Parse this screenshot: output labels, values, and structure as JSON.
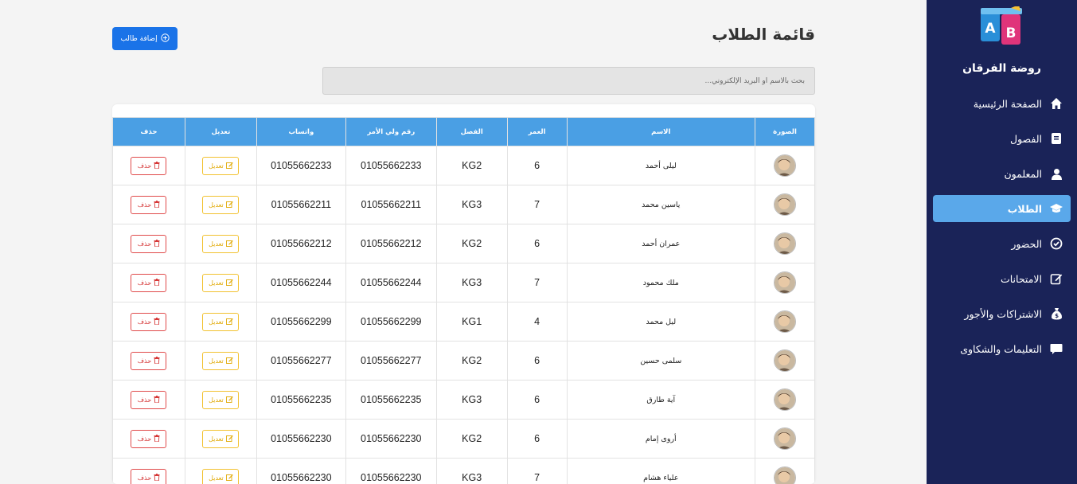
{
  "sidebar": {
    "brand": "روضة الفرقان",
    "logo_text": "A B",
    "items": [
      {
        "label": "الصفحة الرئيسية",
        "icon": "home-icon"
      },
      {
        "label": "الفصول",
        "icon": "book-icon"
      },
      {
        "label": "المعلمون",
        "icon": "user-icon"
      },
      {
        "label": "الطلاب",
        "icon": "graduation-cap-icon",
        "active": true
      },
      {
        "label": "الحضور",
        "icon": "check-circle-icon"
      },
      {
        "label": "الامتحانات",
        "icon": "edit-icon"
      },
      {
        "label": "الاشتراكات والأجور",
        "icon": "money-bag-icon"
      },
      {
        "label": "التعليمات والشكاوى",
        "icon": "comment-icon"
      }
    ]
  },
  "header": {
    "title": "قائمة الطلاب",
    "add_button": "إضافة طالب"
  },
  "search": {
    "placeholder": "بحث بالاسم أو البريد الإلكتروني..."
  },
  "table": {
    "columns": [
      "الصورة",
      "الاسم",
      "العمر",
      "الفصل",
      "رقم ولي الأمر",
      "واتساب",
      "تعديل",
      "حذف"
    ],
    "edit_label": "تعديل",
    "delete_label": "حذف",
    "rows": [
      {
        "name": "ليلى أحمد",
        "age": "6",
        "class": "KG2",
        "parent": "01055662233",
        "whatsapp": "01055662233"
      },
      {
        "name": "ياسين محمد",
        "age": "7",
        "class": "KG3",
        "parent": "01055662211",
        "whatsapp": "01055662211"
      },
      {
        "name": "عمران أحمد",
        "age": "6",
        "class": "KG2",
        "parent": "01055662212",
        "whatsapp": "01055662212"
      },
      {
        "name": "ملك محمود",
        "age": "7",
        "class": "KG3",
        "parent": "01055662244",
        "whatsapp": "01055662244"
      },
      {
        "name": "ليل محمد",
        "age": "4",
        "class": "KG1",
        "parent": "01055662299",
        "whatsapp": "01055662299"
      },
      {
        "name": "سلمى حسين",
        "age": "6",
        "class": "KG2",
        "parent": "01055662277",
        "whatsapp": "01055662277"
      },
      {
        "name": "آية طارق",
        "age": "6",
        "class": "KG3",
        "parent": "01055662235",
        "whatsapp": "01055662235"
      },
      {
        "name": "أروى إمام",
        "age": "6",
        "class": "KG2",
        "parent": "01055662230",
        "whatsapp": "01055662230"
      },
      {
        "name": "علياء هشام",
        "age": "7",
        "class": "KG3",
        "parent": "01055662230",
        "whatsapp": "01055662230"
      }
    ]
  },
  "colors": {
    "sidebar_bg": "#1a2358",
    "active_item": "#5aa8ea",
    "table_header": "#4a9fe4",
    "primary_button": "#1a73e8",
    "edit": "#f2c230",
    "delete": "#e04a4a"
  }
}
